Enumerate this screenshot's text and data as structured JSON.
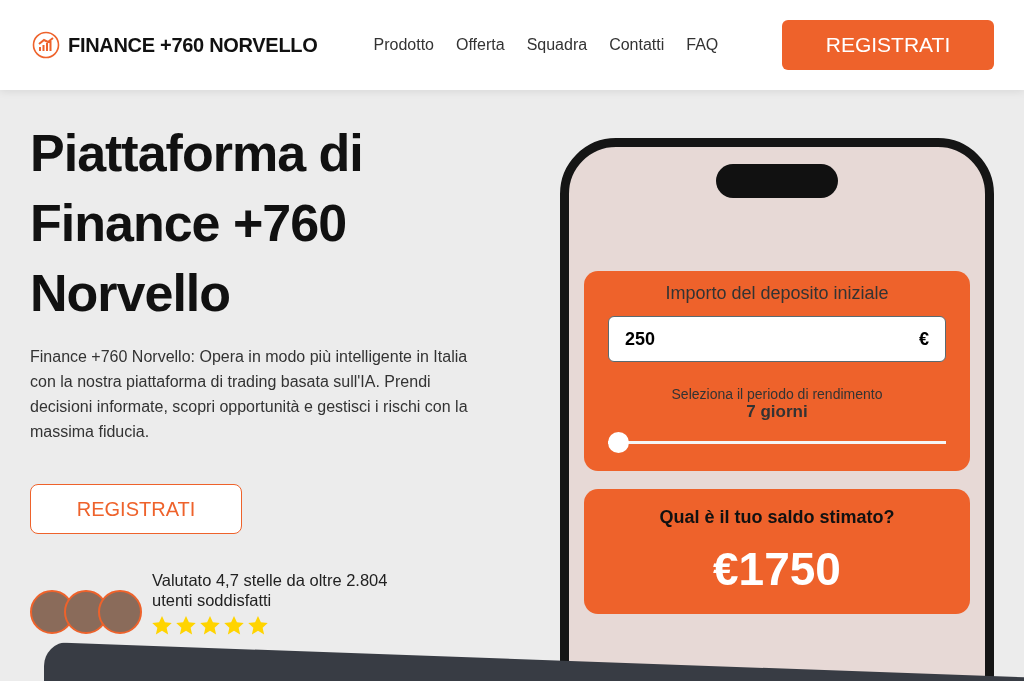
{
  "header": {
    "brand": "FINANCE +760 NORVELLO",
    "nav": [
      "Prodotto",
      "Offerta",
      "Squadra",
      "Contatti",
      "FAQ"
    ],
    "cta": "REGISTRATI"
  },
  "hero": {
    "title": "Piattaforma di Finance +760 Norvello",
    "description": "Finance +760 Norvello: Opera in modo più intelligente in Italia con la nostra piattaforma di trading basata sull'IA. Prendi decisioni informate, scopri opportunità e gestisci i rischi con la massima fiducia.",
    "cta": "REGISTRATI",
    "rating": {
      "text": "Valutato 4,7 stelle da oltre 2.804 utenti soddisfatti",
      "stars": 5
    }
  },
  "calculator": {
    "deposit_label": "Importo del deposito iniziale",
    "deposit_value": "250",
    "currency": "€",
    "period_label": "Seleziona il periodo di rendimento",
    "period_value": "7 giorni",
    "period": {
      "level": 0
    },
    "result_label": "Qual è il tuo saldo stimato?",
    "result_value": "€1750"
  }
}
